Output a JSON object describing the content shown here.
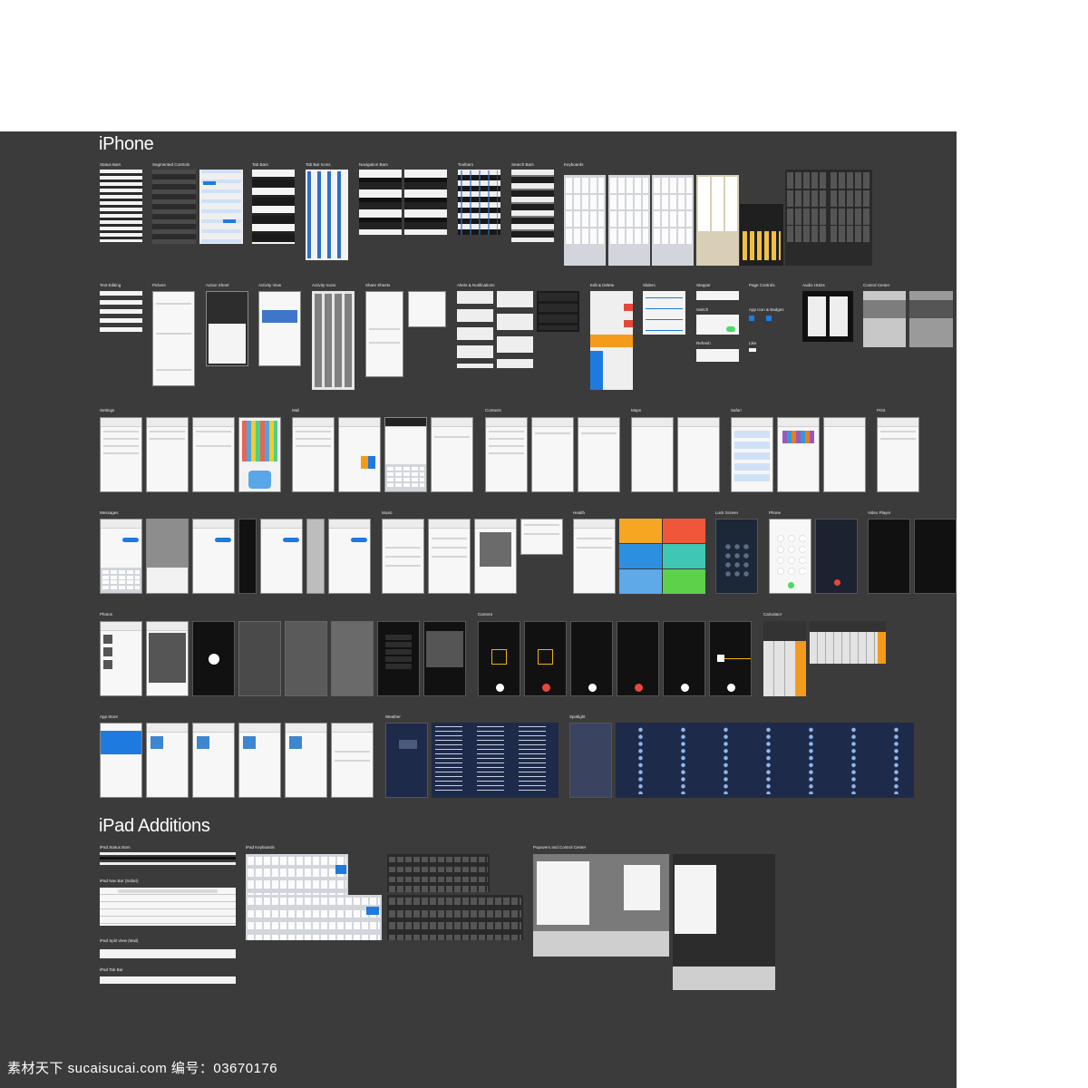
{
  "board_title": "iPhone",
  "ipad_title": "iPad Additions",
  "iphone_labels": {
    "status_bars": "Status Bars",
    "segmented_controls": "Segmented Controls",
    "tab_bars": "Tab Bars",
    "tab_bar_icons": "Tab Bar Icons",
    "navigation_bars": "Navigation Bars",
    "toolbars": "Toolbars",
    "search_bars": "Search Bars",
    "keyboards": "Keyboards",
    "text_editing": "Text Editing",
    "pickers": "Pickers",
    "action_sheet": "Action Sheet",
    "activity_view": "Activity View",
    "activity_icons": "Activity Icons",
    "share_sheets": "Share Sheets",
    "alerts_notifications": "Alerts & Notifications",
    "edit_delete": "Edit & Delete",
    "sliders": "Sliders",
    "stepper": "Stepper",
    "switch": "Switch",
    "refresh": "Refresh",
    "page_controls": "Page Controls",
    "app_icon_badges": "App Icon & Badges",
    "like": "Like",
    "audio_huds": "Audio HUDs",
    "control_center": "Control Center",
    "settings": "Settings",
    "mail": "Mail",
    "contacts": "Contacts",
    "maps": "Maps",
    "safari": "Safari",
    "print": "Print",
    "messages": "Messages",
    "music": "Music",
    "health": "Health",
    "lock_screen": "Lock Screen",
    "phone": "Phone",
    "video_player": "Video Player",
    "photos": "Photos",
    "camera": "Camera",
    "calculator": "Calculator",
    "app_store": "App Store",
    "weather": "Weather",
    "spotlight": "Spotlight"
  },
  "ipad_labels": {
    "status_bars": "iPad Status Bars",
    "nav_bar_safari": "iPad Nav Bar (Safari)",
    "split_view_mail": "iPad Split View (Mail)",
    "tab_bar": "iPad Tab Bar",
    "keyboards": "iPad Keyboards",
    "popovers_control_center": "Popovers and Control Center"
  },
  "colors": {
    "board": "#3b3b3b",
    "accent": "#1f7ae0",
    "orange": "#f59b1c",
    "weather_bg": "#1e2a4a"
  },
  "watermark": "素材天下 sucaisucai.com    编号：03670176"
}
